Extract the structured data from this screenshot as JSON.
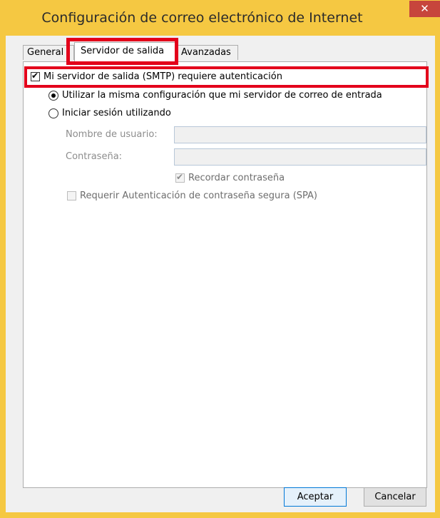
{
  "window": {
    "title": "Configuración de correo electrónico de Internet",
    "close_glyph": "✕"
  },
  "tabs": [
    {
      "label": "General"
    },
    {
      "label": "Servidor de salida"
    },
    {
      "label": "Avanzadas"
    }
  ],
  "outgoing": {
    "requires_auth_label": "Mi servidor de salida (SMTP) requiere autenticación",
    "requires_auth_checked": true,
    "same_config_label": "Utilizar la misma configuración que mi servidor de correo de entrada",
    "login_using_label": "Iniciar sesión utilizando",
    "username_label": "Nombre de usuario:",
    "username_value": "",
    "password_label": "Contraseña:",
    "password_value": "",
    "remember_password_label": "Recordar contraseña",
    "spa_label": "Requerir Autenticación de contraseña segura (SPA)"
  },
  "buttons": {
    "ok": "Aceptar",
    "cancel": "Cancelar"
  },
  "colors": {
    "frame": "#f5c842",
    "close": "#c7453c",
    "highlight": "#e3001b"
  }
}
